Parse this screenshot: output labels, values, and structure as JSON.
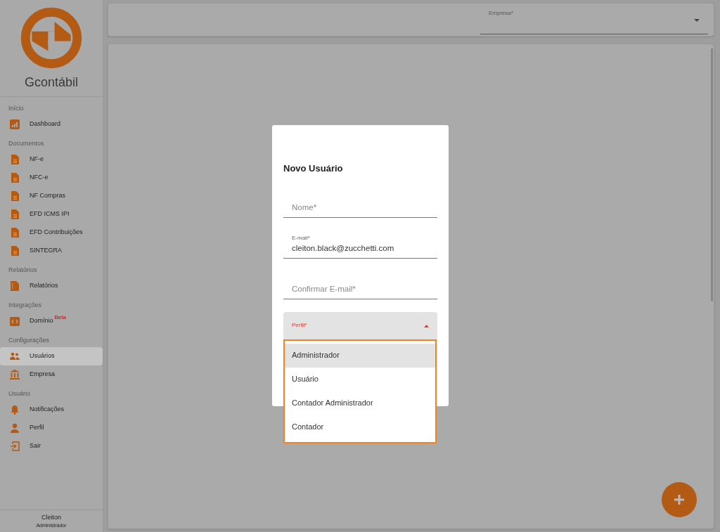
{
  "app": {
    "name": "Gcontábil"
  },
  "sidebar": {
    "sections": [
      {
        "title": "Início",
        "items": [
          {
            "label": "Dashboard",
            "kind": "chart",
            "selected": false
          }
        ]
      },
      {
        "title": "Documentos",
        "items": [
          {
            "label": "NF-e",
            "kind": "document",
            "selected": false
          },
          {
            "label": "NFC-e",
            "kind": "document",
            "selected": false
          },
          {
            "label": "NF Compras",
            "kind": "document",
            "selected": false
          },
          {
            "label": "EFD ICMS IPI",
            "kind": "document",
            "selected": false
          },
          {
            "label": "EFD Contribuições",
            "kind": "document",
            "selected": false
          },
          {
            "label": "SINTEGRA",
            "kind": "document",
            "selected": false
          }
        ]
      },
      {
        "title": "Relatórios",
        "items": [
          {
            "label": "Relatórios",
            "kind": "report",
            "selected": false
          }
        ]
      },
      {
        "title": "Integrações",
        "items": [
          {
            "label": "Domínio",
            "kind": "code",
            "badge": "Beta",
            "selected": false
          }
        ]
      },
      {
        "title": "Configurações",
        "items": [
          {
            "label": "Usuários",
            "kind": "users",
            "selected": true
          },
          {
            "label": "Empresa",
            "kind": "bank",
            "selected": false
          }
        ]
      },
      {
        "title": "Usuário",
        "items": [
          {
            "label": "Notificações",
            "kind": "bell",
            "selected": false
          },
          {
            "label": "Perfil",
            "kind": "person",
            "selected": false
          },
          {
            "label": "Sair",
            "kind": "exit",
            "selected": false
          }
        ]
      }
    ]
  },
  "user": {
    "name": "Cleiton",
    "role": "Administrador"
  },
  "topbar": {
    "company_field": {
      "label": "Empresa*"
    }
  },
  "dialog": {
    "title": "Novo Usuário",
    "fields": [
      {
        "kind": "text",
        "placeholder": "Nome*"
      },
      {
        "kind": "text",
        "label": "E-mail*",
        "value": "cleiton.black@zucchetti.com"
      },
      {
        "kind": "text",
        "placeholder": "Confirmar E-mail*"
      },
      {
        "kind": "select",
        "label": "Perfil*",
        "expanded": true,
        "options": [
          {
            "label": "Administrador",
            "selected": true
          },
          {
            "label": "Usuário",
            "selected": false
          },
          {
            "label": "Contador Administrador",
            "selected": false
          },
          {
            "label": "Contador",
            "selected": false
          }
        ]
      }
    ]
  }
}
